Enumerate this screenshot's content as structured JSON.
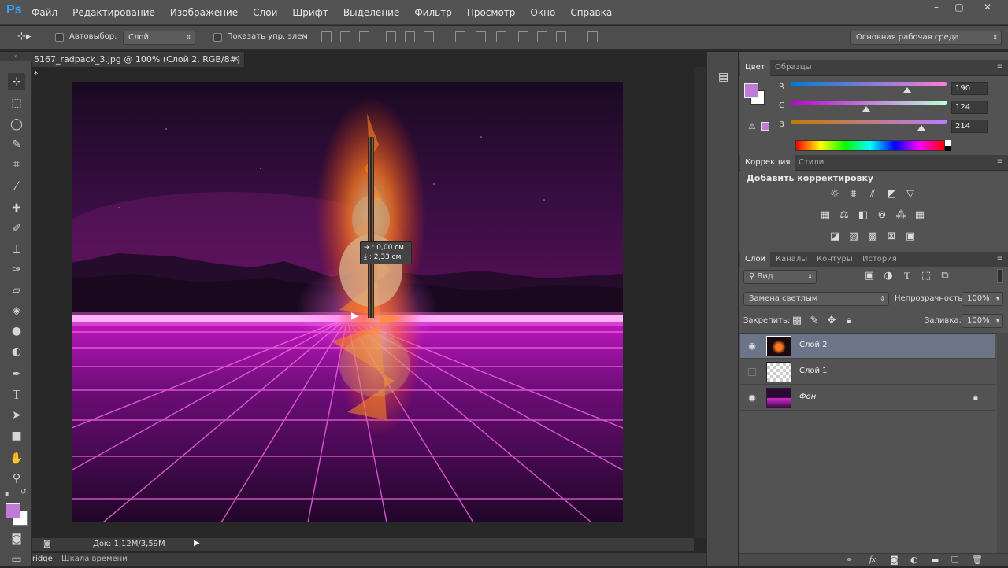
{
  "app": {
    "logo_text": "Ps"
  },
  "menu": [
    "Файл",
    "Редактирование",
    "Изображение",
    "Слои",
    "Шрифт",
    "Выделение",
    "Фильтр",
    "Просмотр",
    "Окно",
    "Справка"
  ],
  "window_controls": [
    "–",
    "▢",
    "✕"
  ],
  "options": {
    "autoselect_label": "Автовыбор:",
    "autoselect_value": "Слой",
    "show_transform_label": "Показать упр. элем.",
    "workspace": "Основная рабочая среда"
  },
  "document": {
    "tab_title": "5167_radpack_3.jpg @ 100% (Слой 2, RGB/8#) *",
    "tooltip_x": "0,00 см",
    "tooltip_y": "2,33 см",
    "status": "Док: 1,12M/3,59M",
    "bottom_tab_bridge": "ridge",
    "bottom_tab_timeline": "Шкала времени"
  },
  "color_panel": {
    "tabs": [
      "Цвет",
      "Образцы"
    ],
    "r_label": "R",
    "g_label": "G",
    "b_label": "B",
    "r": "190",
    "g": "124",
    "b": "214",
    "r_level": 0.745,
    "g_level": 0.486,
    "b_level": 0.839,
    "fg_color": "#be7cd6",
    "bg_color": "#ffffff"
  },
  "adjust_panel": {
    "tabs": [
      "Коррекция",
      "Стили"
    ],
    "add_label": "Добавить корректировку",
    "icons": [
      "brightness-icon",
      "levels-icon",
      "curves-icon",
      "exposure-icon",
      "vibrance-icon",
      "hue-saturation-icon",
      "color-balance-icon",
      "black-white-icon",
      "photo-filter-icon",
      "channel-mixer-icon",
      "color-lookup-icon",
      "invert-icon",
      "posterize-icon",
      "threshold-icon",
      "gradient-map-icon",
      "selective-color-icon"
    ]
  },
  "layers_panel": {
    "tabs": [
      "Слои",
      "Каналы",
      "Контуры",
      "История"
    ],
    "filter_label": "Вид",
    "blend_mode": "Замена светлым",
    "opacity_label": "Непрозрачность:",
    "opacity_value": "100%",
    "lock_label": "Закрепить:",
    "fill_label": "Заливка:",
    "fill_value": "100%",
    "layers": [
      {
        "name": "Слой 2",
        "visible": true,
        "selected": true
      },
      {
        "name": "Слой 1",
        "visible": false,
        "selected": false
      },
      {
        "name": "Фон",
        "visible": true,
        "selected": false,
        "locked": true
      }
    ]
  }
}
